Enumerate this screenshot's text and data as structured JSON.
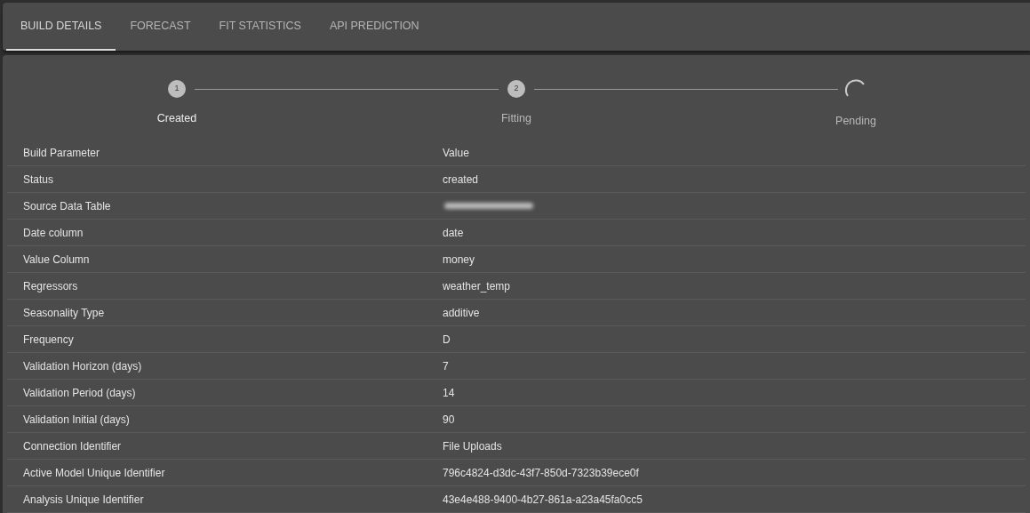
{
  "tabs": [
    {
      "label": "BUILD DETAILS",
      "selected": true
    },
    {
      "label": "FORECAST",
      "selected": false
    },
    {
      "label": "FIT STATISTICS",
      "selected": false
    },
    {
      "label": "API PREDICTION",
      "selected": false
    }
  ],
  "stepper": [
    {
      "kind": "number",
      "number": "1",
      "label": "Created",
      "active": true
    },
    {
      "kind": "number",
      "number": "2",
      "label": "Fitting",
      "active": false
    },
    {
      "kind": "spinner",
      "label": "Pending",
      "active": false
    }
  ],
  "table": {
    "columns": [
      "Build Parameter",
      "Value"
    ],
    "rows": [
      {
        "parameter": "Status",
        "value": "created"
      },
      {
        "parameter": "Source Data Table",
        "redacted": true
      },
      {
        "parameter": "Date column",
        "value": "date"
      },
      {
        "parameter": "Value Column",
        "value": "money"
      },
      {
        "parameter": "Regressors",
        "value": "weather_temp"
      },
      {
        "parameter": "Seasonality Type",
        "value": "additive"
      },
      {
        "parameter": "Frequency",
        "value": "D"
      },
      {
        "parameter": "Validation Horizon (days)",
        "value": "7"
      },
      {
        "parameter": "Validation Period (days)",
        "value": "14"
      },
      {
        "parameter": "Validation Initial (days)",
        "value": "90"
      },
      {
        "parameter": "Connection Identifier",
        "value": "File Uploads"
      },
      {
        "parameter": "Active Model Unique Identifier",
        "value": "796c4824-d3dc-43f7-850d-7323b39ece0f"
      },
      {
        "parameter": "Analysis Unique Identifier",
        "value": "43e4e488-9400-4b27-861a-a23a45fa0cc5"
      }
    ]
  }
}
